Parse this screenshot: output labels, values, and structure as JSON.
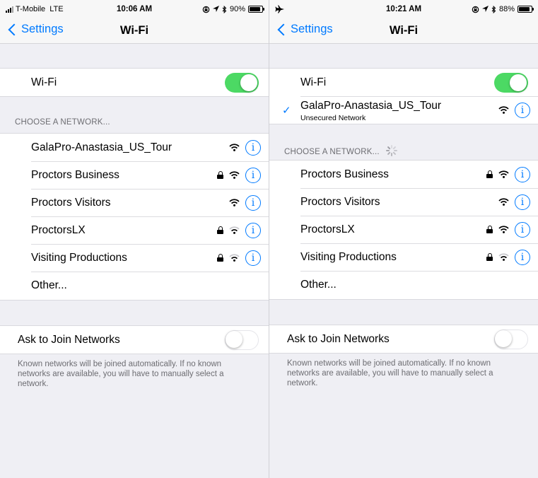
{
  "left": {
    "status": {
      "carrier": "T-Mobile",
      "network": "LTE",
      "time": "10:06 AM",
      "battery": "90%",
      "battery_level": 0.9
    },
    "nav": {
      "back_label": "Settings",
      "title": "Wi-Fi"
    },
    "wifi": {
      "label": "Wi-Fi",
      "on": true
    },
    "choose_header": "CHOOSE A NETWORK...",
    "networks": [
      {
        "name": "GalaPro-Anastasia_US_Tour",
        "secured": false
      },
      {
        "name": "Proctors Business",
        "secured": true
      },
      {
        "name": "Proctors Visitors",
        "secured": false
      },
      {
        "name": "ProctorsLX",
        "secured": true
      },
      {
        "name": "Visiting Productions",
        "secured": true
      }
    ],
    "other_label": "Other...",
    "ask": {
      "label": "Ask to Join Networks",
      "on": false
    },
    "footer": "Known networks will be joined automatically. If no known networks are available, you will have to manually select a network."
  },
  "right": {
    "status": {
      "time": "10:21 AM",
      "battery": "88%",
      "battery_level": 0.88
    },
    "nav": {
      "back_label": "Settings",
      "title": "Wi-Fi"
    },
    "wifi": {
      "label": "Wi-Fi",
      "on": true
    },
    "connected": {
      "name": "GalaPro-Anastasia_US_Tour",
      "subtitle": "Unsecured Network"
    },
    "choose_header": "CHOOSE A NETWORK...",
    "networks": [
      {
        "name": "Proctors Business",
        "secured": true
      },
      {
        "name": "Proctors Visitors",
        "secured": false
      },
      {
        "name": "ProctorsLX",
        "secured": true
      },
      {
        "name": "Visiting Productions",
        "secured": true
      }
    ],
    "other_label": "Other...",
    "ask": {
      "label": "Ask to Join Networks",
      "on": false
    },
    "footer": "Known networks will be joined automatically. If no known networks are available, you will have to manually select a network."
  },
  "colors": {
    "accent": "#007aff",
    "toggle_on": "#4cd964",
    "background": "#efeff4"
  }
}
